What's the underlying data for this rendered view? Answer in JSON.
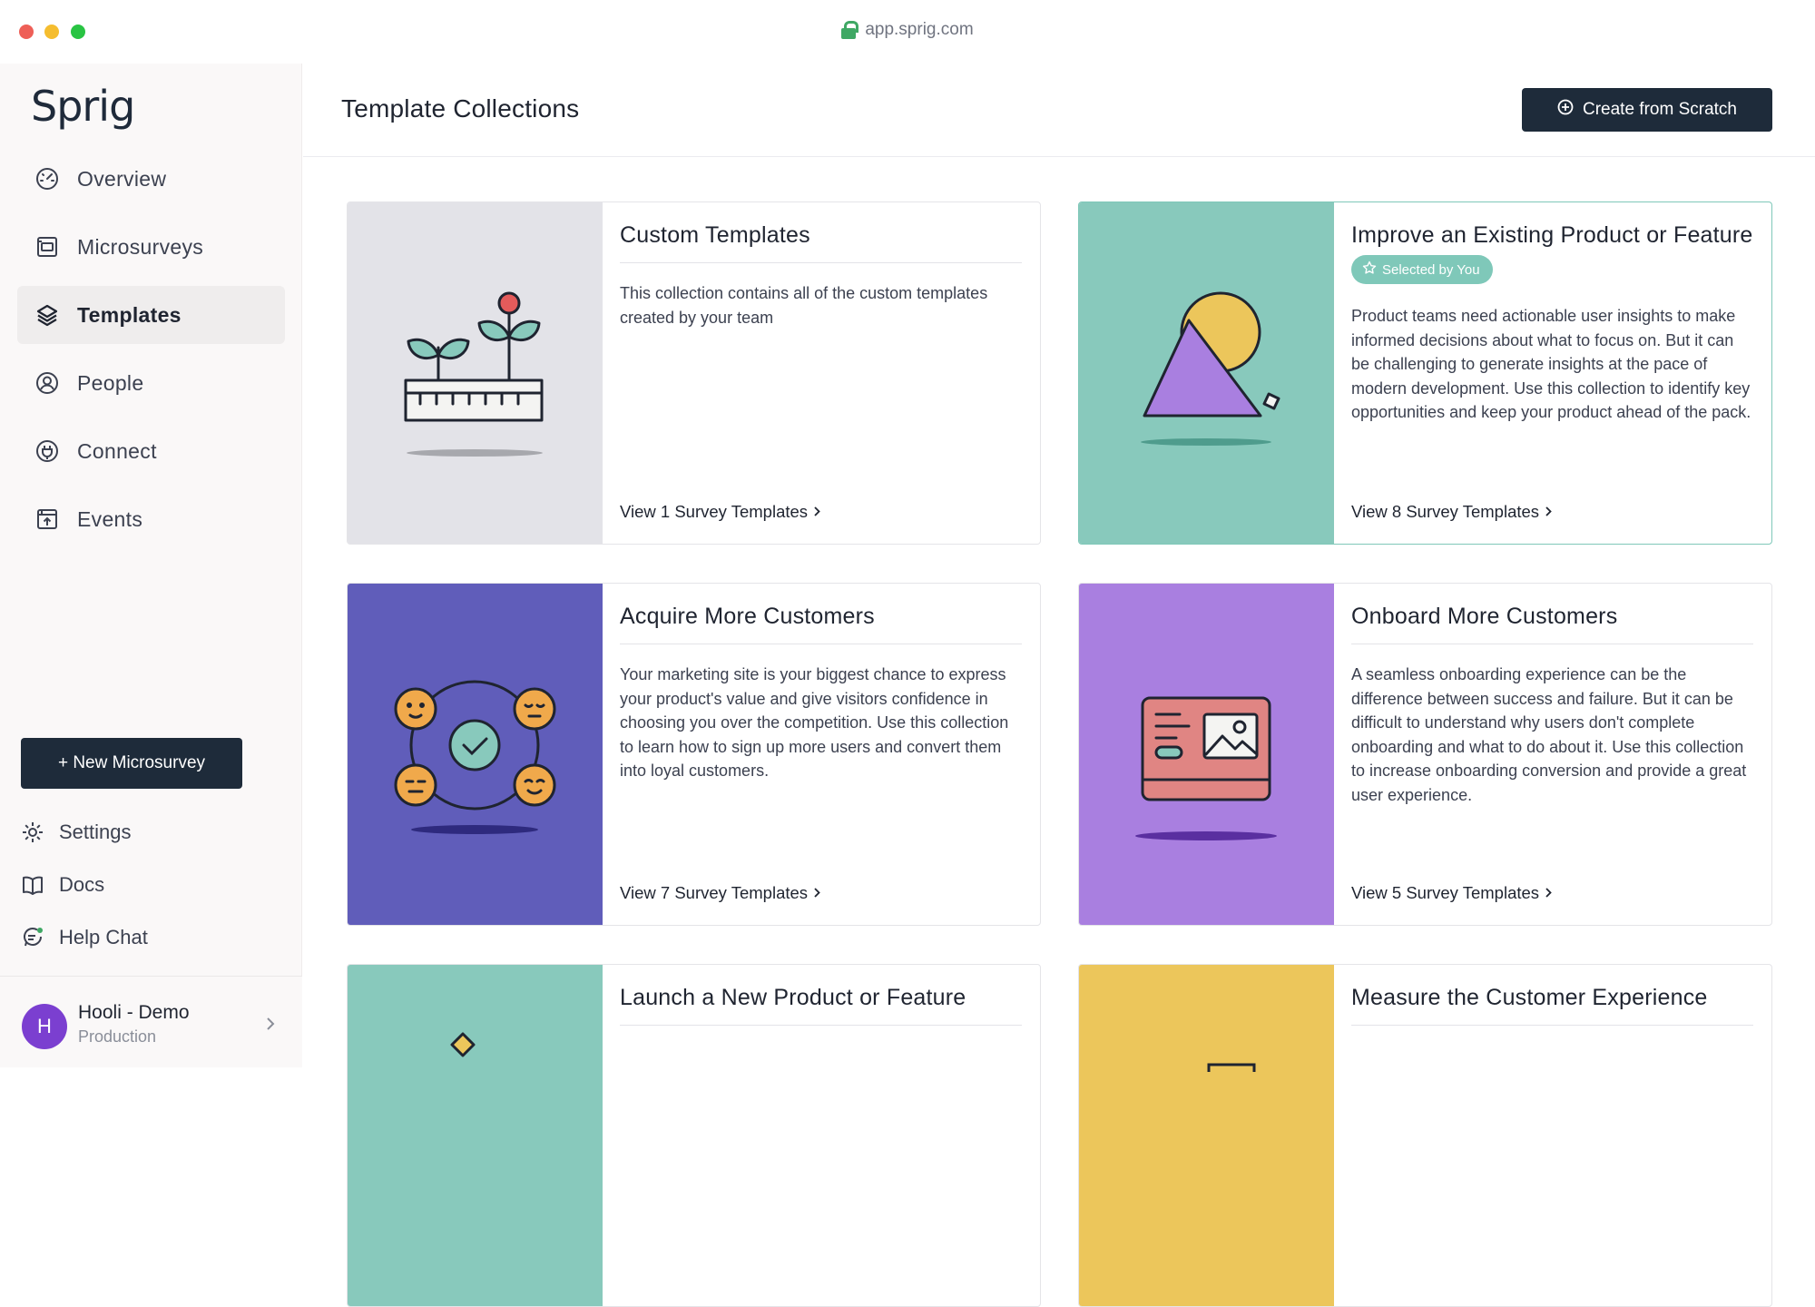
{
  "browser": {
    "url": "app.sprig.com"
  },
  "sidebar": {
    "logo": "Sprig",
    "nav": [
      {
        "label": "Overview",
        "icon": "gauge-icon",
        "active": false
      },
      {
        "label": "Microsurveys",
        "icon": "survey-icon",
        "active": false
      },
      {
        "label": "Templates",
        "icon": "layers-icon",
        "active": true
      },
      {
        "label": "People",
        "icon": "user-circle-icon",
        "active": false
      },
      {
        "label": "Connect",
        "icon": "plug-icon",
        "active": false
      },
      {
        "label": "Events",
        "icon": "events-icon",
        "active": false
      }
    ],
    "new_button": "+ New Microsurvey",
    "bottom_links": [
      {
        "label": "Settings",
        "icon": "gear-icon"
      },
      {
        "label": "Docs",
        "icon": "book-icon"
      },
      {
        "label": "Help Chat",
        "icon": "chat-icon"
      }
    ],
    "org": {
      "initial": "H",
      "name": "Hooli - Demo",
      "environment": "Production"
    }
  },
  "header": {
    "title": "Template Collections",
    "create_button": "Create from Scratch"
  },
  "colors": {
    "primary_dark": "#1e2b3a",
    "teal": "#88c9bc",
    "indigo": "#605dba",
    "lavender": "#a97fe0",
    "mustard": "#ecc65b",
    "grey_panel": "#e3e3e8",
    "avatar": "#7b3fd0"
  },
  "collections": [
    {
      "title": "Custom Templates",
      "description": "This collection contains all of the custom templates created by your team",
      "link": "View 1 Survey Templates",
      "selected": false,
      "badge": ""
    },
    {
      "title": "Improve an Existing Product or Feature",
      "description": "Product teams need actionable user insights to make informed decisions about what to focus on. But it can be challenging to generate insights at the pace of modern development. Use this collection to identify key opportunities and keep your product ahead of the pack.",
      "link": "View 8 Survey Templates",
      "selected": true,
      "badge": "Selected by You"
    },
    {
      "title": "Acquire More Customers",
      "description": "Your marketing site is your biggest chance to express your product's value and give visitors confidence in choosing you over the competition. Use this collection to learn how to sign up more users and convert them into loyal customers.",
      "link": "View 7 Survey Templates",
      "selected": false,
      "badge": ""
    },
    {
      "title": "Onboard More Customers",
      "description": "A seamless onboarding experience can be the difference between success and failure. But it can be difficult to understand why users don't complete onboarding and what to do about it. Use this collection to increase onboarding conversion and provide a great user experience.",
      "link": "View 5 Survey Templates",
      "selected": false,
      "badge": ""
    },
    {
      "title": "Launch a New Product or Feature",
      "selected": false
    },
    {
      "title": "Measure the Customer Experience",
      "selected": false
    }
  ]
}
